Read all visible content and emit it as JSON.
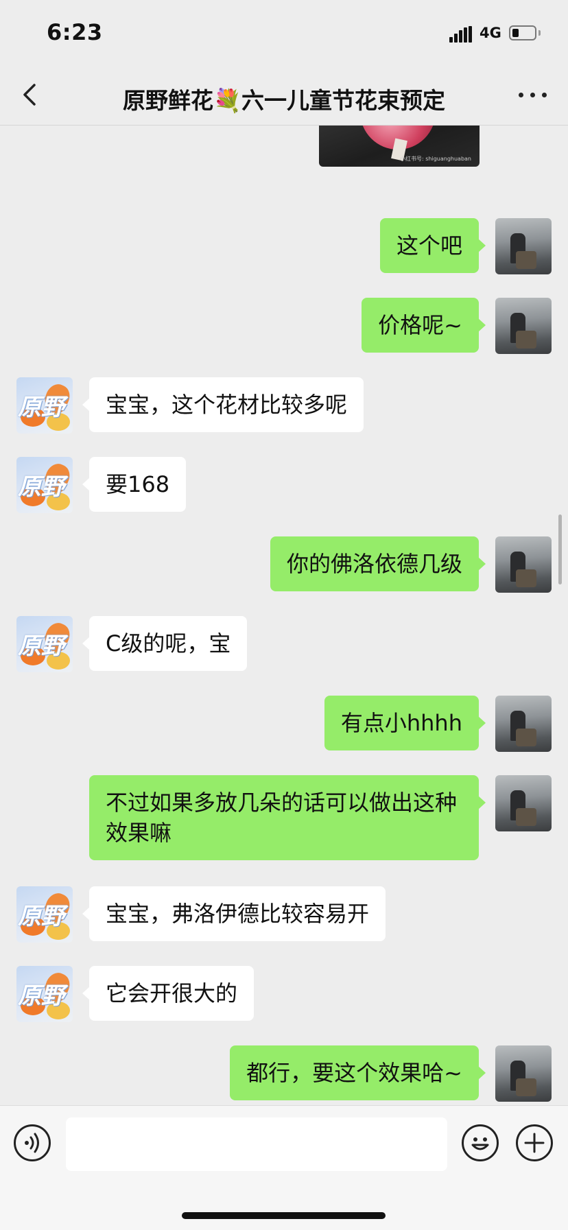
{
  "status_bar": {
    "time": "6:23",
    "network": "4G"
  },
  "header": {
    "title": "原野鲜花💐六一儿童节花束预定"
  },
  "image_message": {
    "watermark": "小红书号: shiguanghuaban"
  },
  "messages": [
    {
      "side": "out",
      "text": "这个吧"
    },
    {
      "side": "out",
      "text": "价格呢~"
    },
    {
      "side": "in",
      "text": "宝宝，这个花材比较多呢"
    },
    {
      "side": "in",
      "text": "要168"
    },
    {
      "side": "out",
      "text": "你的佛洛依德几级"
    },
    {
      "side": "in",
      "text": "C级的呢，宝"
    },
    {
      "side": "out",
      "text": "有点小hhhh"
    },
    {
      "side": "out",
      "text": "不过如果多放几朵的话可以做出这种效果嘛"
    },
    {
      "side": "in",
      "text": "宝宝，弗洛伊德比较容易开"
    },
    {
      "side": "in",
      "text": "它会开很大的"
    },
    {
      "side": "out",
      "text": "都行，要这个效果哈~"
    }
  ],
  "shop_avatar_text": "原野",
  "input": {
    "value": "",
    "placeholder": ""
  },
  "icons": [
    "back-icon",
    "more-icon",
    "voice-icon",
    "emoji-icon",
    "plus-icon"
  ]
}
